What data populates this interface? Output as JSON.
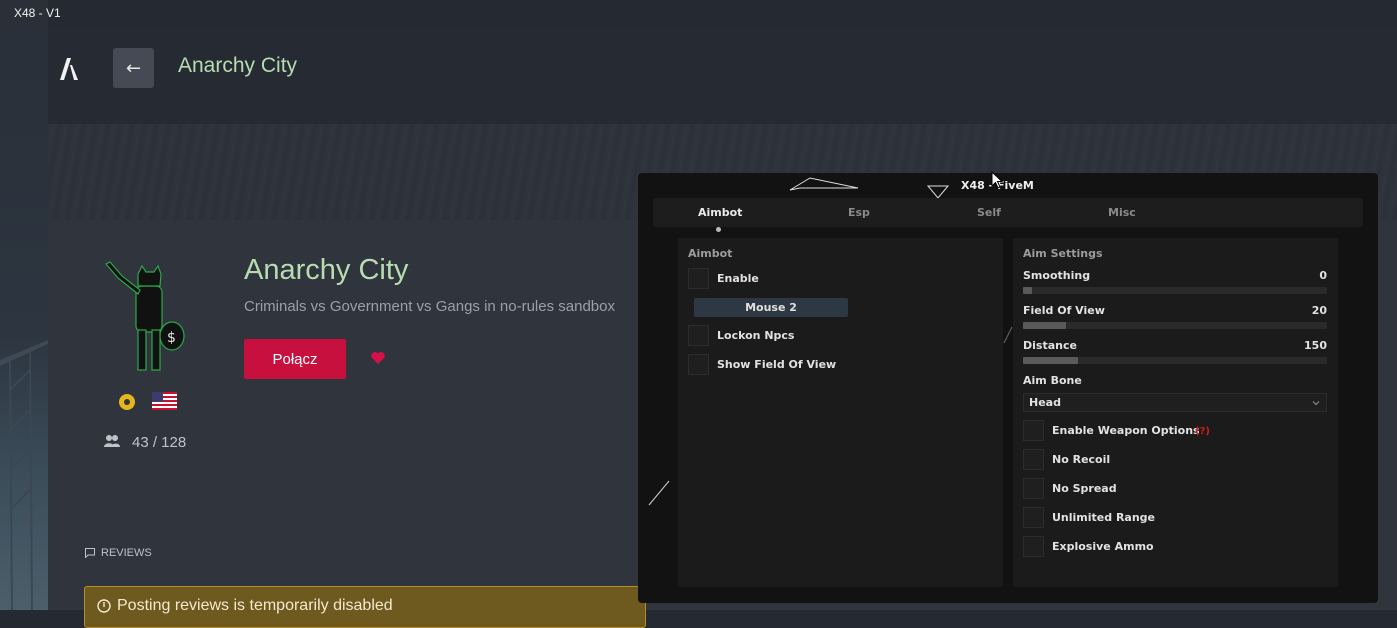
{
  "window": {
    "title": "X48 - V1"
  },
  "header": {
    "back_label": "←",
    "title": "Anarchy City"
  },
  "server": {
    "name": "Anarchy City",
    "description": "Criminals vs Government vs Gangs in no-rules sandbox",
    "connect_label": "Połącz",
    "players": "43 / 128"
  },
  "reviews": {
    "label": "REVIEWS",
    "notice": "Posting reviews is temporarily disabled"
  },
  "colors": {
    "accent_green": "#b6dcb0",
    "connect_red": "#c8103f",
    "heart_red": "#d5104a",
    "menu_bg": "#121212",
    "help_red": "#d21a1a"
  },
  "menu": {
    "title": "X48 - FiveM",
    "tabs": [
      {
        "label": "Aimbot",
        "active": true
      },
      {
        "label": "Esp",
        "active": false
      },
      {
        "label": "Self",
        "active": false
      },
      {
        "label": "Misc",
        "active": false
      }
    ],
    "aimbot_panel": {
      "title": "Aimbot",
      "enable_label": "Enable",
      "keybind": "Mouse 2",
      "lockon_label": "Lockon Npcs",
      "fov_label": "Show Field Of View"
    },
    "settings_panel": {
      "title": "Aim Settings",
      "sliders": [
        {
          "label": "Smoothing",
          "value": "0",
          "fraction": 0.03
        },
        {
          "label": "Field Of View",
          "value": "20",
          "fraction": 0.14
        },
        {
          "label": "Distance",
          "value": "150",
          "fraction": 0.18
        }
      ],
      "bone_label": "Aim Bone",
      "bone_value": "Head",
      "options": [
        {
          "label": "Enable Weapon Options",
          "help": "(?)"
        },
        {
          "label": "No Recoil"
        },
        {
          "label": "No Spread"
        },
        {
          "label": "Unlimited Range"
        },
        {
          "label": "Explosive Ammo"
        }
      ]
    }
  }
}
